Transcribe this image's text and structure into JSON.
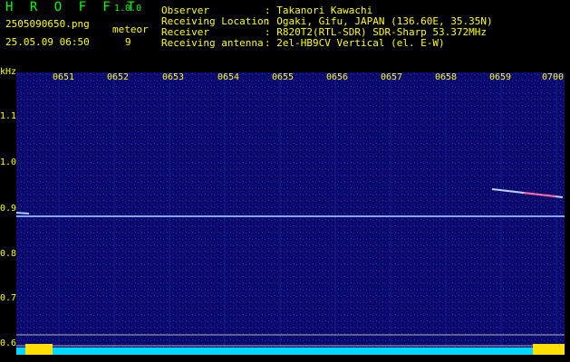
{
  "header": {
    "app_name": "H R O F F T",
    "version": "1.0.0",
    "filename": "2505090650.png",
    "date_time": "25.05.09 06:50",
    "meteor_label": "meteor",
    "meteor_count": "9",
    "observer_label": "Observer",
    "observer_value": ": Takanori Kawachi",
    "location_label": "Receiving Location",
    "location_value": ": Ogaki, Gifu, JAPAN (136.60E, 35.35N)",
    "receiver_label": "Receiver",
    "receiver_value": ": R820T2(RTL-SDR) SDR-Sharp 53.372MHz",
    "antenna_label": "Receiving antenna",
    "antenna_value": ": 2el-HB9CV Vertical (el. E-W)"
  },
  "axis": {
    "y_unit": "kHz",
    "x_ticks": [
      "0651",
      "0652",
      "0653",
      "0654",
      "0655",
      "0656",
      "0657",
      "0658",
      "0659",
      "0700"
    ],
    "y_ticks": [
      "1.1",
      "1.0",
      "0.9",
      "0.8",
      "0.7",
      "0.6"
    ]
  },
  "colors": {
    "background": "#000000",
    "spectrogram_bg": "#0a0a6a",
    "label_yellow": "#ffff00",
    "title_green": "#00ff00",
    "signal_line": "#8fb7ff",
    "meteor_trail": "#ff60a0"
  }
}
